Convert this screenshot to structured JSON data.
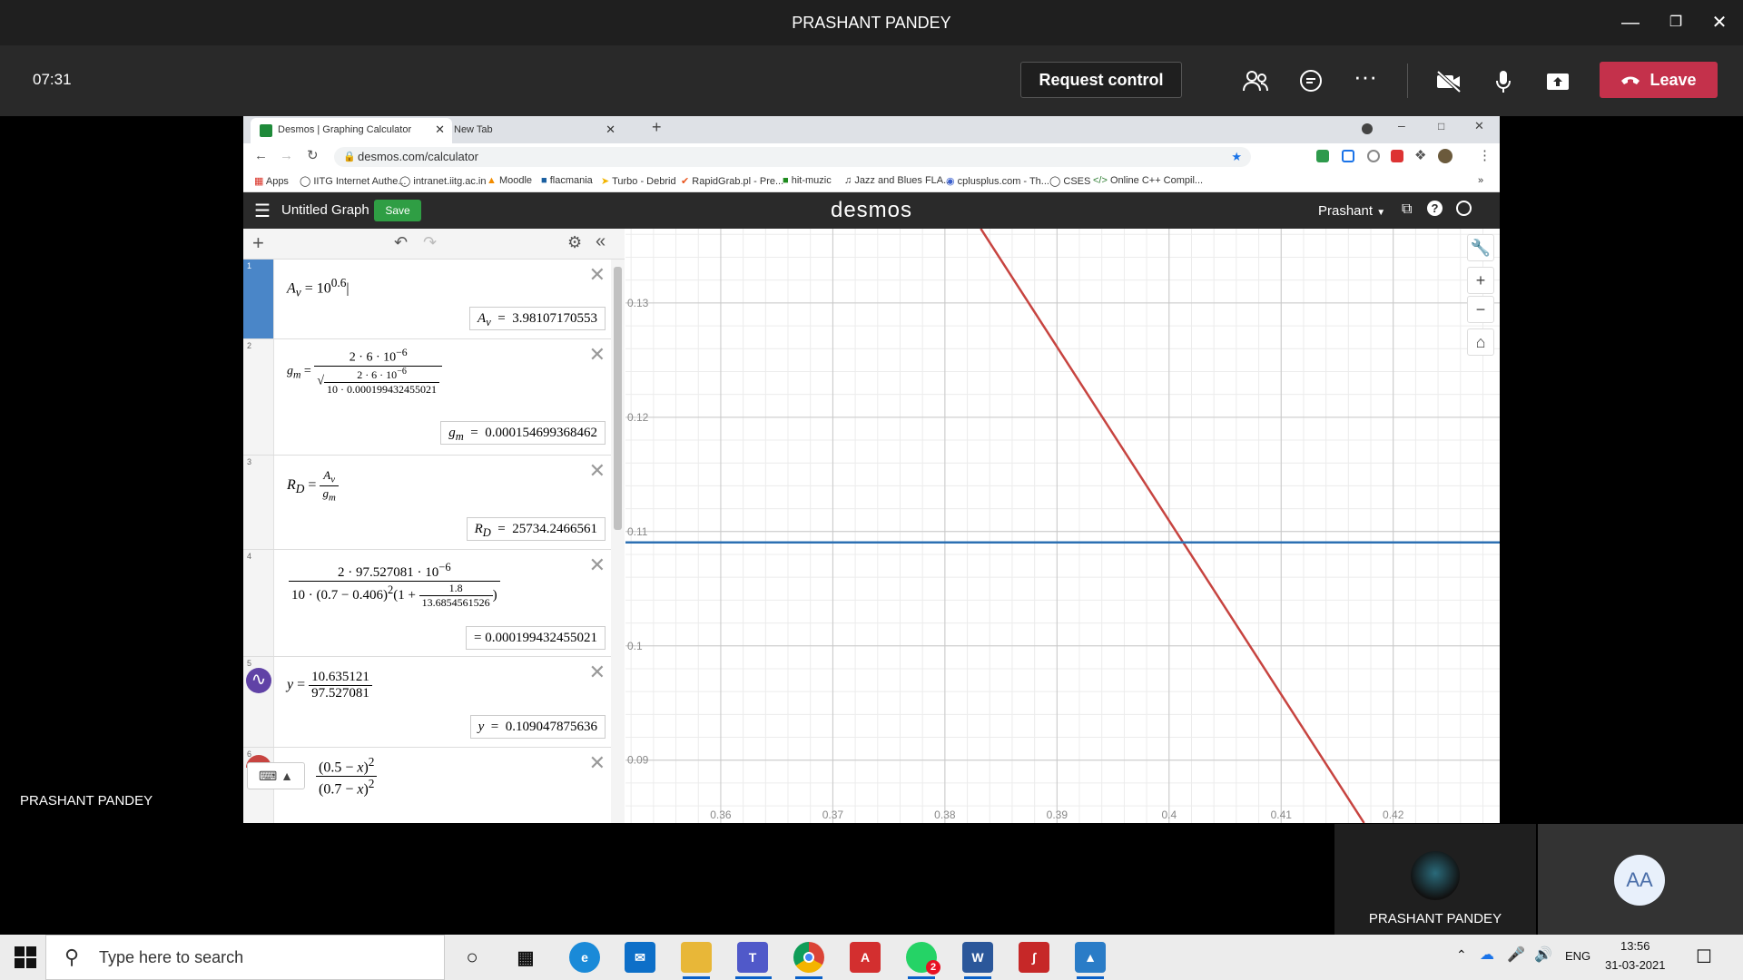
{
  "window": {
    "title": "PRASHANT PANDEY"
  },
  "call": {
    "timer": "07:31",
    "request_control": "Request control",
    "leave": "Leave",
    "presenter_label": "PRASHANT PANDEY"
  },
  "browser": {
    "tabs": [
      {
        "label": "Desmos | Graphing Calculator"
      },
      {
        "label": "New Tab"
      }
    ],
    "url": "desmos.com/calculator",
    "bookmarks": [
      "Apps",
      "IITG Internet Authe...",
      "intranet.iitg.ac.in",
      "Moodle",
      "flacmania",
      "Turbo - Debrid",
      "RapidGrab.pl - Pre...",
      "hit-muzic",
      "Jazz and Blues FLA...",
      "cplusplus.com - Th...",
      "CSES",
      "Online C++ Compil..."
    ]
  },
  "desmos": {
    "graph_title": "Untitled Graph",
    "save_label": "Save",
    "logo": "desmos",
    "user": "Prashant",
    "expressions": [
      {
        "num": "1",
        "result": "3.98107170553"
      },
      {
        "num": "2",
        "result": "0.000154699368462"
      },
      {
        "num": "3",
        "result": "25734.2466561"
      },
      {
        "num": "4",
        "result": "= 0.000199432455021"
      },
      {
        "num": "5",
        "result": "0.109047875636"
      },
      {
        "num": "6"
      }
    ],
    "x_ticks": [
      "0.36",
      "0.37",
      "0.38",
      "0.39",
      "0.4",
      "0.41",
      "0.42"
    ],
    "y_ticks": [
      "0.13",
      "0.12",
      "0.11",
      "0.1",
      "0.09"
    ]
  },
  "chart_data": {
    "type": "line",
    "xlim": [
      0.3515,
      0.4295
    ],
    "ylim": [
      0.0845,
      0.1365
    ],
    "series": [
      {
        "points": [
          [
            0.3832,
            0.1365
          ],
          [
            0.4174,
            0.0845
          ]
        ],
        "color": "#c74440"
      },
      {
        "points": [
          [
            0.3515,
            0.10905
          ],
          [
            0.4295,
            0.10905
          ]
        ],
        "color": "#2d70b3"
      }
    ],
    "grid": true
  },
  "participants": [
    {
      "name": "PRASHANT PANDEY"
    },
    {
      "initials": "AA"
    }
  ],
  "taskbar": {
    "search_placeholder": "Type here to search",
    "lang": "ENG",
    "time": "13:56",
    "date": "31-03-2021",
    "whatsapp_badge": "2"
  }
}
